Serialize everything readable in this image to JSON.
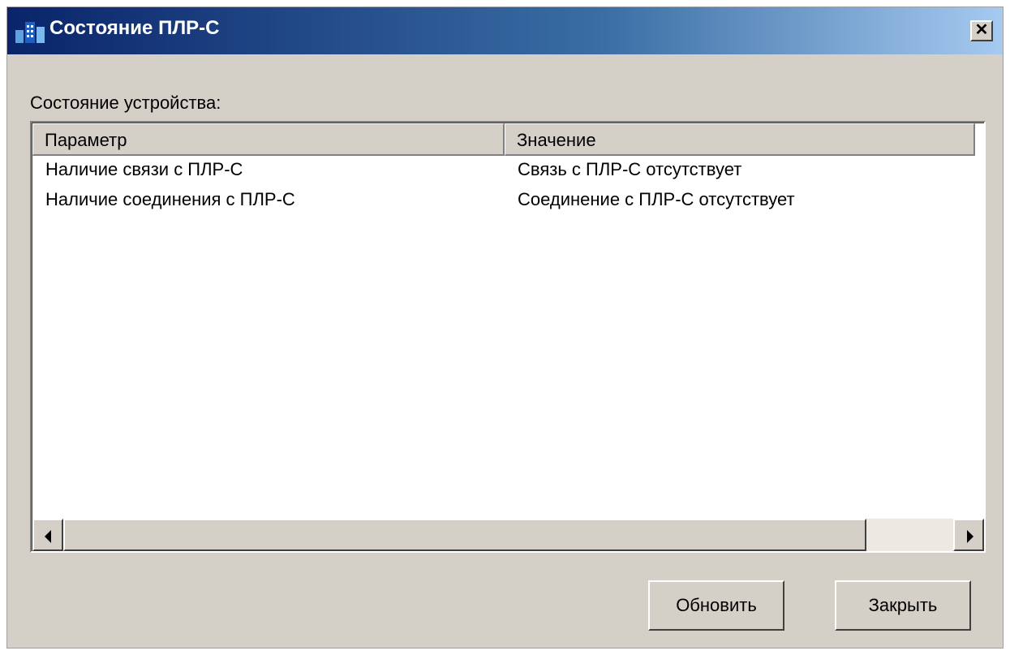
{
  "window": {
    "title": "Состояние ПЛР-С",
    "close_glyph": "✕",
    "icon": "building-app-icon"
  },
  "section": {
    "label": "Состояние устройства:"
  },
  "table": {
    "columns": [
      "Параметр",
      "Значение"
    ],
    "rows": [
      {
        "param": "Наличие связи с ПЛР-С",
        "value": "Связь с ПЛР-С отсутствует"
      },
      {
        "param": "Наличие соединения с ПЛР-С",
        "value": "Соединение с ПЛР-С отсутствует"
      }
    ]
  },
  "buttons": {
    "refresh": "Обновить",
    "close": "Закрыть"
  },
  "colors": {
    "title_gradient_start": "#0a246a",
    "title_gradient_end": "#a6caf0",
    "face": "#d4d0c8"
  }
}
